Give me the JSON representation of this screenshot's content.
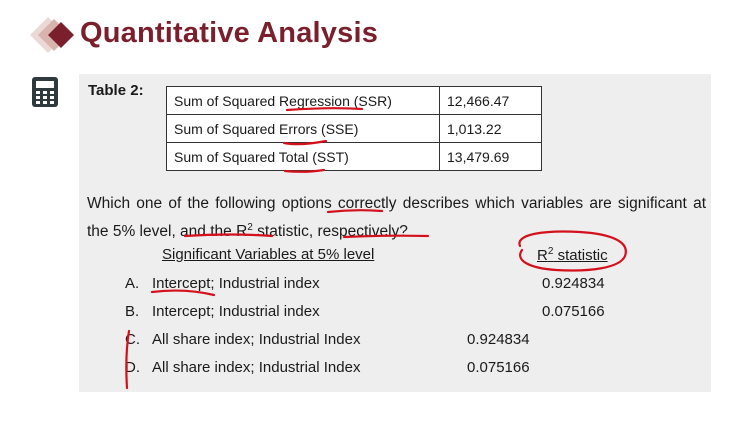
{
  "header": {
    "title": "Quantitative Analysis"
  },
  "table": {
    "label": "Table 2:",
    "rows": [
      {
        "name": "Sum of Squared Regression (SSR)",
        "value": "12,466.47"
      },
      {
        "name": "Sum of Squared Errors (SSE)",
        "value": "1,013.22"
      },
      {
        "name": "Sum of Squared Total (SST)",
        "value": "13,479.69"
      }
    ]
  },
  "question": {
    "part1": "Which one of the following options correctly describes which variables are significant at the 5% level, and the R",
    "sup": "2",
    "part2": " statistic, respectively?"
  },
  "columns": {
    "significant": "Significant Variables at 5% level",
    "r2_base": "R",
    "r2_sup": "2",
    "r2_rest": " statistic"
  },
  "options": [
    {
      "letter": "A.",
      "text": "Intercept; Industrial index",
      "value": "0.924834"
    },
    {
      "letter": "B.",
      "text": "Intercept; Industrial index",
      "value": "0.075166"
    },
    {
      "letter": "C.",
      "text": "All share index; Industrial Index",
      "value": "0.924834"
    },
    {
      "letter": "D.",
      "text": "All share index; Industrial Index",
      "value": "0.075166"
    }
  ],
  "colors": {
    "brand": "#7a1f2b",
    "annotation": "#d4101c",
    "panel": "#eeeeee"
  },
  "icons": [
    "diamond-logo-icon",
    "calculator-icon"
  ]
}
